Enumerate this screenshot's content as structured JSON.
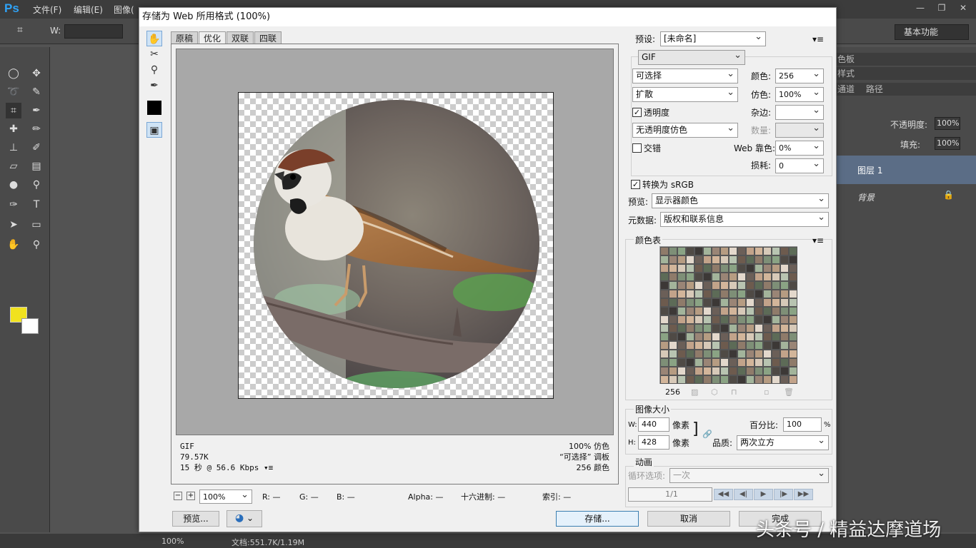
{
  "app": {
    "menu": [
      "文件(F)",
      "编辑(E)",
      "图像("
    ],
    "workspace": "基本功能",
    "status_zoom": "100%",
    "status_doc": "文档:551.7K/1.19M",
    "watermark": "头条号 / 精益达摩道场",
    "layers": {
      "tab1": "色板",
      "tab2": "样式",
      "tab3": "通道",
      "tab4": "路径",
      "opacity_label": "不透明度:",
      "opacity": "100%",
      "fill_label": "填充:",
      "fill": "100%",
      "layer1": "图层 1",
      "background": "背景"
    }
  },
  "dialog": {
    "title": "存储为 Web 所用格式 (100%)",
    "tabs": [
      "原稿",
      "优化",
      "双联",
      "四联"
    ],
    "info_left": {
      "format": "GIF",
      "size": "79.57K",
      "time": "15 秒 @ 56.6 Kbps"
    },
    "info_right": {
      "dither": "100% 仿色",
      "palette": "“可选择” 调板",
      "colors": "256 颜色"
    },
    "zoom": "100%",
    "readout": {
      "r": "R: —",
      "g": "G: —",
      "b": "B: —",
      "alpha": "Alpha: —",
      "hex": "十六进制: —",
      "index": "索引: —"
    },
    "preview_btn": "预览...",
    "save_btn": "存储...",
    "cancel_btn": "取消",
    "done_btn": "完成",
    "settings": {
      "preset_label": "预设:",
      "preset": "[未命名]",
      "format": "GIF",
      "reduction": "可选择",
      "colors_label": "颜色:",
      "colors": "256",
      "dither_algo": "扩散",
      "dither_label": "仿色:",
      "dither": "100%",
      "transparency": "透明度",
      "matte_label": "杂边:",
      "trans_dither": "无透明度仿色",
      "amount_label": "数量:",
      "interlaced": "交错",
      "websnap_label": "Web 靠色:",
      "websnap": "0%",
      "lossy_label": "损耗:",
      "lossy": "0",
      "convert_srgb": "转换为 sRGB",
      "preview_label": "预览:",
      "preview": "显示器颜色",
      "metadata_label": "元数据:",
      "metadata": "版权和联系信息"
    },
    "color_table": {
      "title": "颜色表",
      "count": "256"
    },
    "image_size": {
      "title": "图像大小",
      "w_label": "W:",
      "w": "440",
      "h_label": "H:",
      "h": "428",
      "unit": "像素",
      "percent_label": "百分比:",
      "percent": "100",
      "percent_unit": "%",
      "quality_label": "品质:",
      "quality": "两次立方"
    },
    "animation": {
      "title": "动画",
      "loop_label": "循环选项:",
      "loop": "一次",
      "frame": "1/1"
    }
  }
}
